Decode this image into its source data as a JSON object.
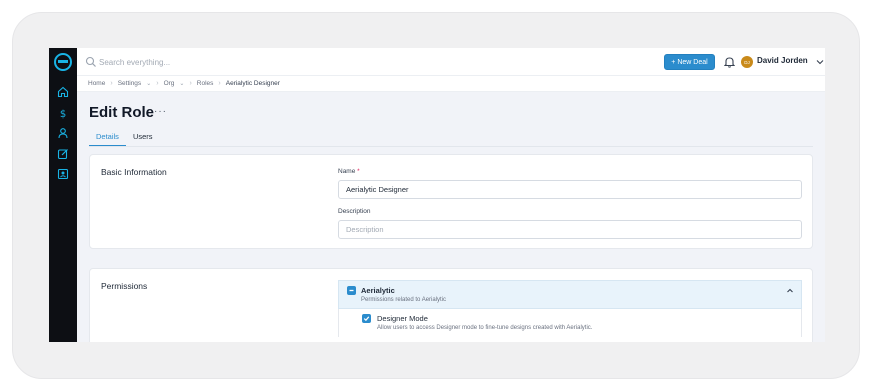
{
  "colors": {
    "accent": "#2b8ccd",
    "rail": "#0d0f14",
    "logo": "#19b4e6",
    "avatar": "#c98a1a"
  },
  "rail": {
    "icons": [
      "logo-icon",
      "home-icon",
      "dollar-icon",
      "user-icon",
      "edit-icon",
      "contact-icon"
    ]
  },
  "topbar": {
    "search_placeholder": "Search everything...",
    "new_deal_label": "+ New Deal",
    "user": {
      "initials": "DJ",
      "name": "David Jorden"
    }
  },
  "breadcrumb": {
    "home": "Home",
    "settings": "Settings",
    "org": "Org",
    "roles": "Roles",
    "current": "Aerialytic Designer"
  },
  "header": {
    "title": "Edit Role",
    "more": "···",
    "tabs": [
      {
        "label": "Details"
      },
      {
        "label": "Users"
      }
    ]
  },
  "basic_info": {
    "title": "Basic Information",
    "name_label": "Name",
    "name_required": "*",
    "name_value": "Aerialytic Designer",
    "description_label": "Description",
    "description_placeholder": "Description"
  },
  "permissions": {
    "title": "Permissions",
    "group": {
      "title": "Aerialytic",
      "description": "Permissions related to Aerialytic",
      "checked": true
    },
    "items": [
      {
        "title": "Designer Mode",
        "description": "Allow users to access Designer mode to fine-tune designs created with Aerialytic.",
        "checked": true
      }
    ]
  }
}
